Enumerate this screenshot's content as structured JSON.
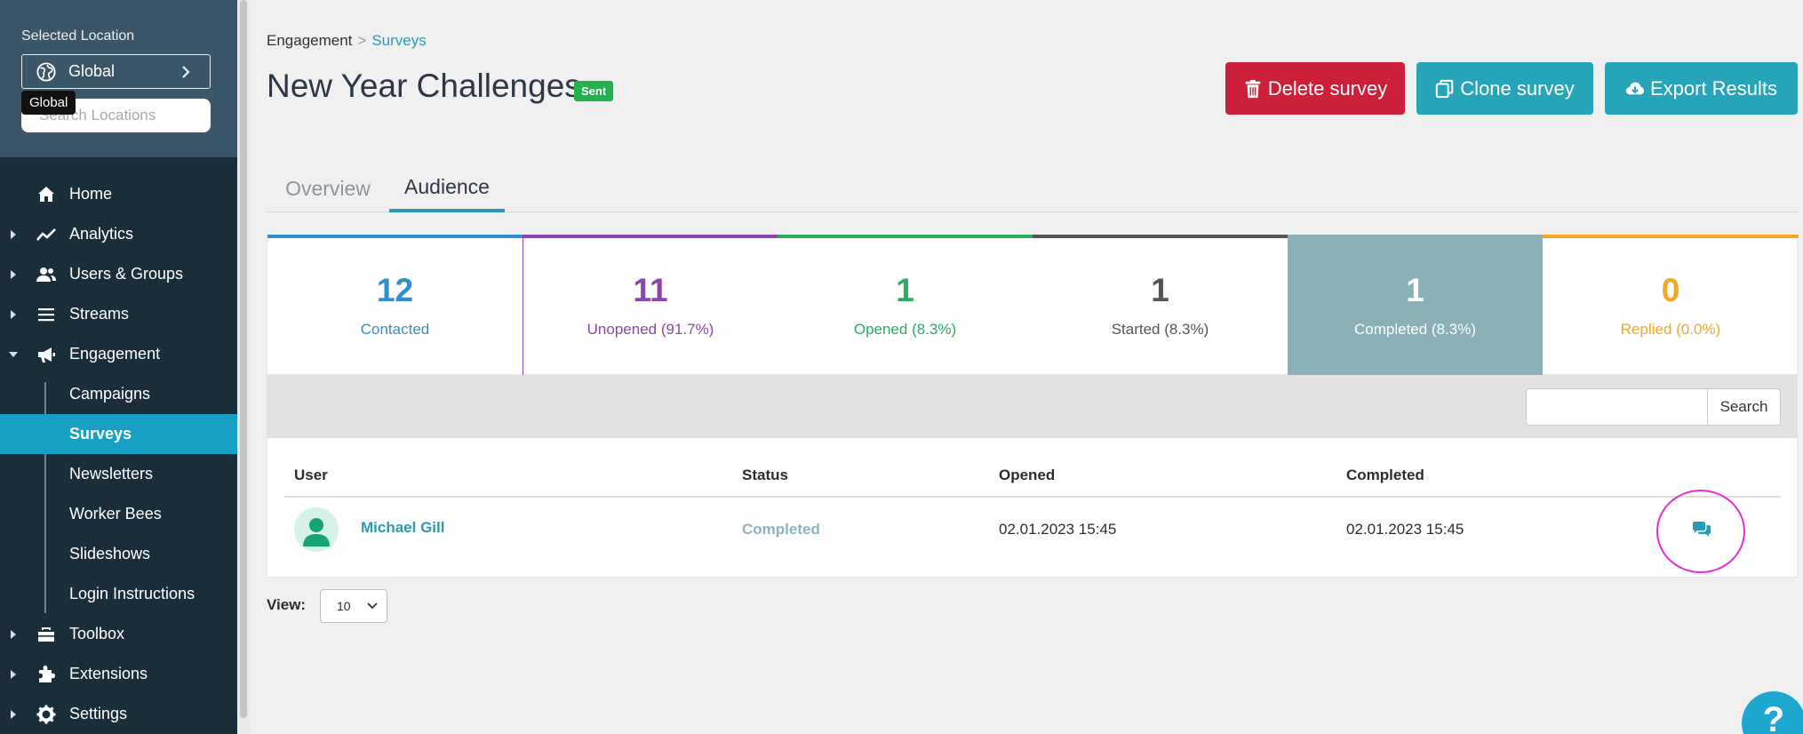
{
  "sidebar": {
    "selected_location_label": "Selected Location",
    "location_button_label": "Global",
    "search_placeholder": "Search Locations",
    "tooltip": "Global",
    "nav": {
      "home": "Home",
      "analytics": "Analytics",
      "users_groups": "Users & Groups",
      "streams": "Streams",
      "engagement": "Engagement",
      "toolbox": "Toolbox",
      "extensions": "Extensions",
      "settings": "Settings"
    },
    "engagement_sub": {
      "campaigns": "Campaigns",
      "surveys": "Surveys",
      "newsletters": "Newsletters",
      "worker_bees": "Worker Bees",
      "slideshows": "Slideshows",
      "login_instructions": "Login Instructions"
    },
    "active_item": "Surveys"
  },
  "breadcrumb": {
    "parent": "Engagement",
    "separator": ">",
    "current": "Surveys"
  },
  "page": {
    "title": "New Year Challenges",
    "status_badge": "Sent"
  },
  "actions": {
    "delete": "Delete survey",
    "clone": "Clone survey",
    "export": "Export Results"
  },
  "tabs": {
    "overview": "Overview",
    "audience": "Audience",
    "active": "Audience"
  },
  "stats": [
    {
      "value": "12",
      "label": "Contacted",
      "color": "#2e8fd0"
    },
    {
      "value": "11",
      "label": "Unopened (91.7%)",
      "color": "#8e44ad"
    },
    {
      "value": "1",
      "label": "Opened (8.3%)",
      "color": "#27ae60"
    },
    {
      "value": "1",
      "label": "Started (8.3%)",
      "color": "#555555"
    },
    {
      "value": "1",
      "label": "Completed (8.3%)",
      "color": "#8ab0b8"
    },
    {
      "value": "0",
      "label": "Replied (0.0%)",
      "color": "#f5a623"
    }
  ],
  "active_stat": "Completed (8.3%)",
  "search": {
    "placeholder": "",
    "button_label": "Search"
  },
  "table": {
    "columns": {
      "user": "User",
      "status": "Status",
      "opened": "Opened",
      "completed": "Completed"
    },
    "rows": [
      {
        "user": "Michael Gill",
        "status": "Completed",
        "opened": "02.01.2023 15:45",
        "completed": "02.01.2023 15:45",
        "action_icon": "comments-icon"
      }
    ]
  },
  "pagination": {
    "view_label": "View:",
    "page_size": "10"
  },
  "help_button": "?",
  "colors": {
    "sidebar_bg": "#1a2d3b",
    "sidebar_top_bg": "#3b5669",
    "accent": "#17a0c3",
    "delete": "#cc1f3a",
    "teal_button": "#28a4b9",
    "sent_badge": "#22b14c",
    "highlight_ring": "#ea2ad6"
  }
}
